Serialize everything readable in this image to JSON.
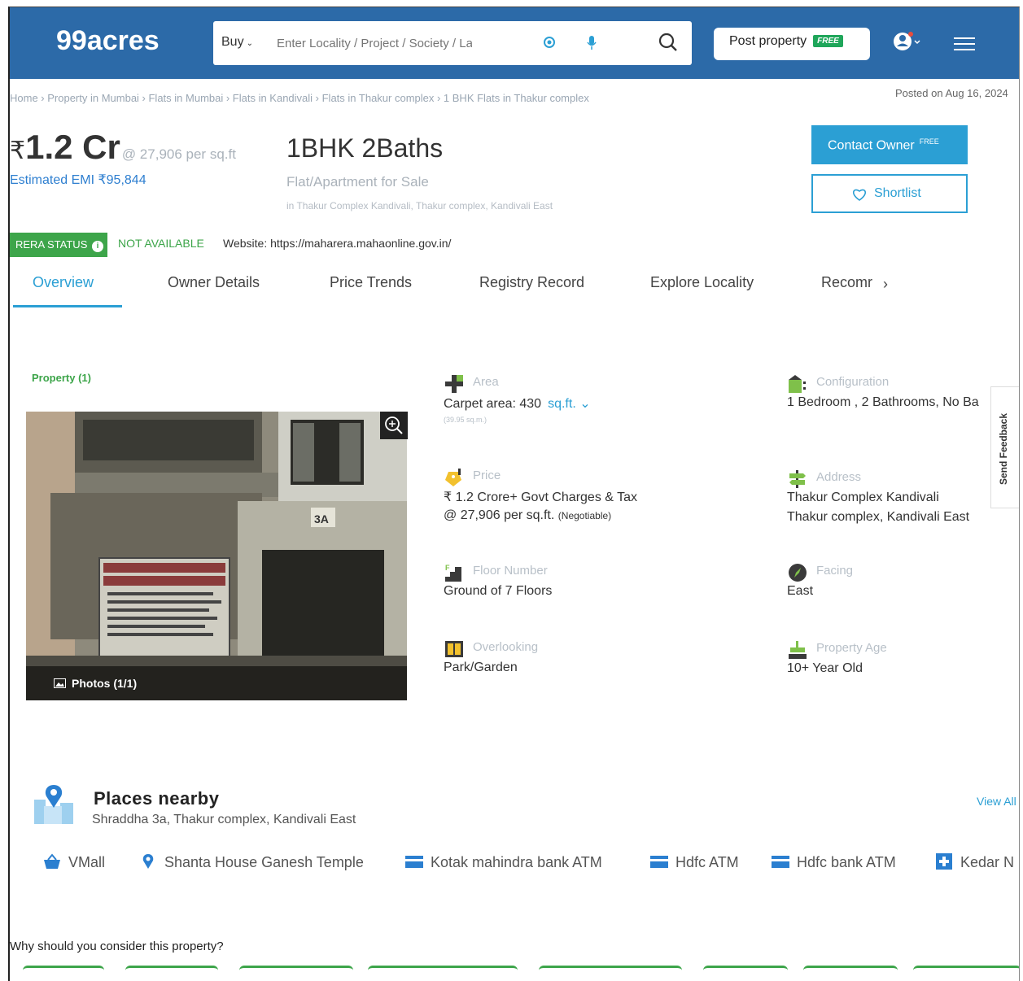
{
  "header": {
    "logo": "99acres",
    "buy_label": "Buy",
    "search_placeholder": "Enter Locality / Project / Society / Landmark",
    "post_label": "Post property",
    "post_badge": "FREE",
    "brand_color": "#2c6aa8"
  },
  "breadcrumb": {
    "text": "Home › Property in Mumbai › Flats in Mumbai › Flats in Kandivali › Flats in Thakur complex › 1 BHK Flats in Thakur complex",
    "posted": "Posted on Aug 16, 2024"
  },
  "listing": {
    "currency": "₹",
    "price": "1.2 Cr",
    "per_sqft": "@ 27,906 per sq.ft",
    "emi": "Estimated EMI ₹95,844",
    "title": "1BHK 2Baths",
    "type": "Flat/Apartment for Sale",
    "location": "in Thakur Complex Kandivali, Thakur complex, Kandivali East",
    "contact_label": "Contact Owner",
    "contact_badge": "FREE",
    "shortlist_label": "Shortlist"
  },
  "rera": {
    "label": "RERA STATUS",
    "info": "i",
    "status": "NOT AVAILABLE",
    "website": "Website: https://maharera.mahaonline.gov.in/"
  },
  "tabs": {
    "overview": "Overview",
    "owner": "Owner Details",
    "price_trends": "Price Trends",
    "registry": "Registry Record",
    "explore": "Explore Locality",
    "recommend": "Recomr"
  },
  "property": {
    "section_label": "Property (1)",
    "photos_label": "Photos (1/1)",
    "area": {
      "label": "Area",
      "value": "Carpet area: 430",
      "unit": "sq.ft.",
      "sub": "(39.95 sq.m.)"
    },
    "config": {
      "label": "Configuration",
      "value": "1 Bedroom , 2 Bathrooms, No Ba"
    },
    "price": {
      "label": "Price",
      "line1": "₹ 1.2 Crore+ Govt Charges & Tax",
      "line2": "@ 27,906 per sq.ft.",
      "negotiable": "(Negotiable)"
    },
    "address": {
      "label": "Address",
      "line1": "Thakur Complex Kandivali",
      "line2": "Thakur complex, Kandivali East"
    },
    "floor": {
      "label": "Floor Number",
      "value": "Ground of 7 Floors"
    },
    "facing": {
      "label": "Facing",
      "value": "East"
    },
    "overlooking": {
      "label": "Overlooking",
      "value": "Park/Garden"
    },
    "age": {
      "label": "Property Age",
      "value": "10+ Year Old"
    },
    "feedback": "Send Feedback"
  },
  "nearby": {
    "title": "Places nearby",
    "subtitle": "Shraddha 3a, Thakur complex, Kandivali East",
    "view_all": "View All",
    "places": [
      "VMall",
      "Shanta House Ganesh Temple",
      "Kotak mahindra bank ATM",
      "Hdfc ATM",
      "Hdfc bank ATM",
      "Kedar N"
    ]
  },
  "why": "Why should you consider this property?"
}
